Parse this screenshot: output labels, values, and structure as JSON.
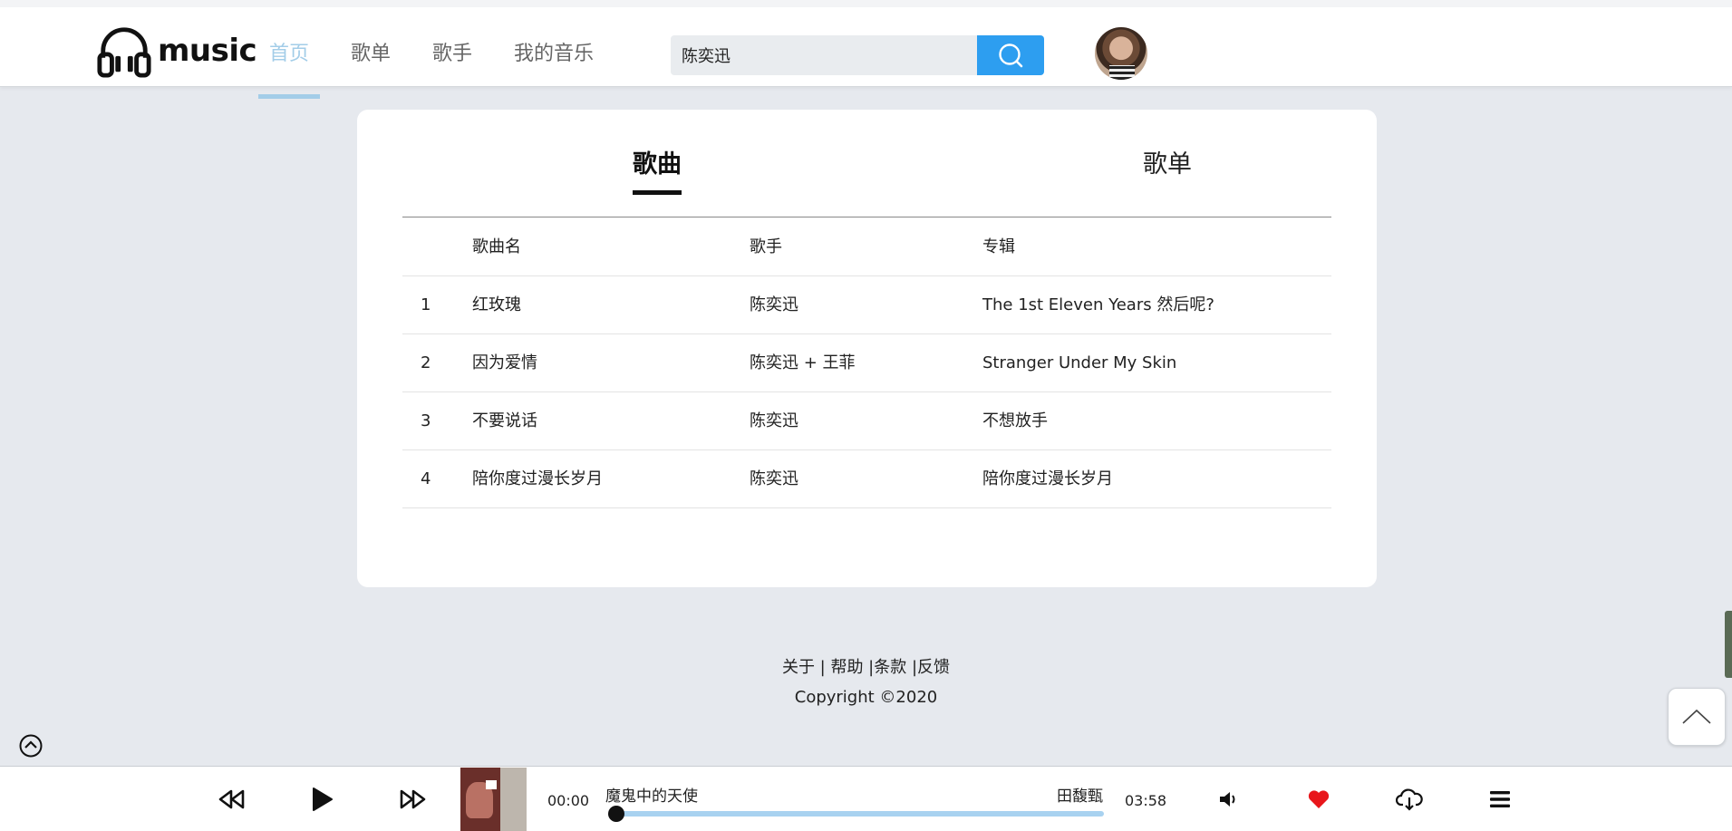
{
  "header": {
    "logo_text": "music",
    "nav": [
      "首页",
      "歌单",
      "歌手",
      "我的音乐"
    ],
    "active_nav": "首页",
    "search_value": "陈奕迅",
    "accent_color": "#a3cde8",
    "search_button_color": "#2d9ef0"
  },
  "results": {
    "tabs": [
      "歌曲",
      "歌单"
    ],
    "active_tab": "歌曲",
    "columns": [
      "歌曲名",
      "歌手",
      "专辑"
    ],
    "rows": [
      {
        "index": "1",
        "name": "红玫瑰",
        "artist": "陈奕迅",
        "album": "The 1st Eleven Years 然后呢?"
      },
      {
        "index": "2",
        "name": "因为爱情",
        "artist": "陈奕迅 + 王菲",
        "album": "Stranger Under My Skin"
      },
      {
        "index": "3",
        "name": "不要说话",
        "artist": "陈奕迅",
        "album": "不想放手"
      },
      {
        "index": "4",
        "name": "陪你度过漫长岁月",
        "artist": "陈奕迅",
        "album": "陪你度过漫长岁月"
      }
    ]
  },
  "footer": {
    "links": "关于 | 帮助 |条款 |反馈",
    "copyright": "Copyright ©2020"
  },
  "player": {
    "current_time": "00:00",
    "total_time": "03:58",
    "song_title": "魔鬼中的天使",
    "song_artist": "田馥甄",
    "progress_fraction": 0,
    "liked": true,
    "like_color": "#e8161b",
    "icons": [
      "rewind-icon",
      "play-icon",
      "fast-forward-icon",
      "volume-icon",
      "heart-icon",
      "cloud-download-icon",
      "playlist-menu-icon"
    ]
  }
}
